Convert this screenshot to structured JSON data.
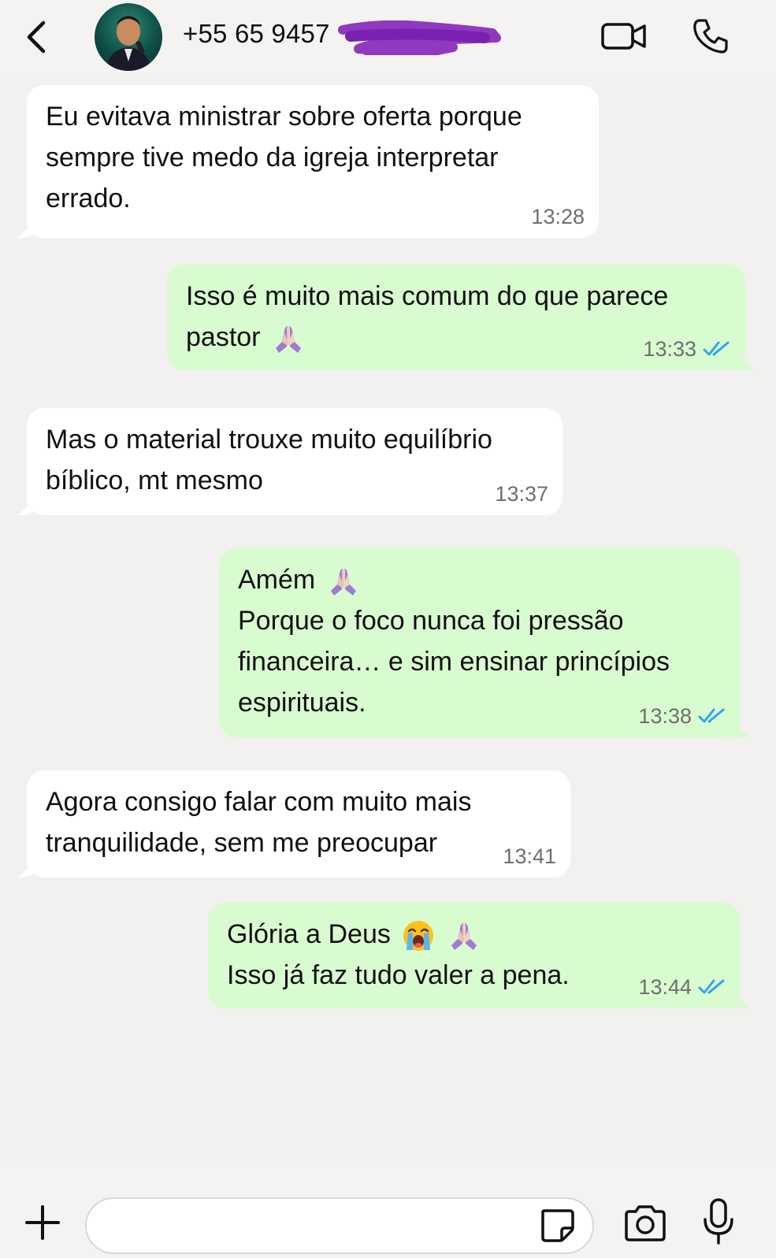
{
  "header": {
    "contact_name": "+55 65 9457",
    "back_icon": "chevron-left-icon",
    "video_icon": "video-call-icon",
    "phone_icon": "phone-icon"
  },
  "colors": {
    "incoming_bubble": "#ffffff",
    "outgoing_bubble": "#d9fbd0",
    "read_ticks": "#34a3ee",
    "redaction": "#8a2dbd"
  },
  "messages": [
    {
      "direction": "incoming",
      "lines": [
        "Eu evitava ministrar sobre oferta porque",
        "sempre tive medo da igreja interpretar",
        "errado."
      ],
      "time": "13:28"
    },
    {
      "direction": "outgoing",
      "lines": [
        "Isso é muito mais comum do que parece",
        "pastor"
      ],
      "emojis": [
        "praying-hands"
      ],
      "time": "13:33",
      "status": "read"
    },
    {
      "direction": "incoming",
      "lines": [
        "Mas o material trouxe muito equilíbrio",
        "bíblico, mt mesmo"
      ],
      "time": "13:37"
    },
    {
      "direction": "outgoing",
      "lines": [
        "Amém",
        "Porque o foco nunca foi pressão",
        "financeira… e sim ensinar princípios",
        "espirituais."
      ],
      "emojis": [
        "praying-hands"
      ],
      "time": "13:38",
      "status": "read"
    },
    {
      "direction": "incoming",
      "lines": [
        "Agora consigo falar com muito mais",
        "tranquilidade, sem me preocupar"
      ],
      "time": "13:41"
    },
    {
      "direction": "outgoing",
      "lines": [
        "Glória a Deus",
        "Isso já faz tudo valer a pena."
      ],
      "emojis": [
        "loudly-crying-face",
        "praying-hands"
      ],
      "time": "13:44",
      "status": "read"
    }
  ],
  "composer": {
    "placeholder": "",
    "icons": [
      "plus-icon",
      "sticker-icon",
      "camera-icon",
      "microphone-icon"
    ]
  }
}
